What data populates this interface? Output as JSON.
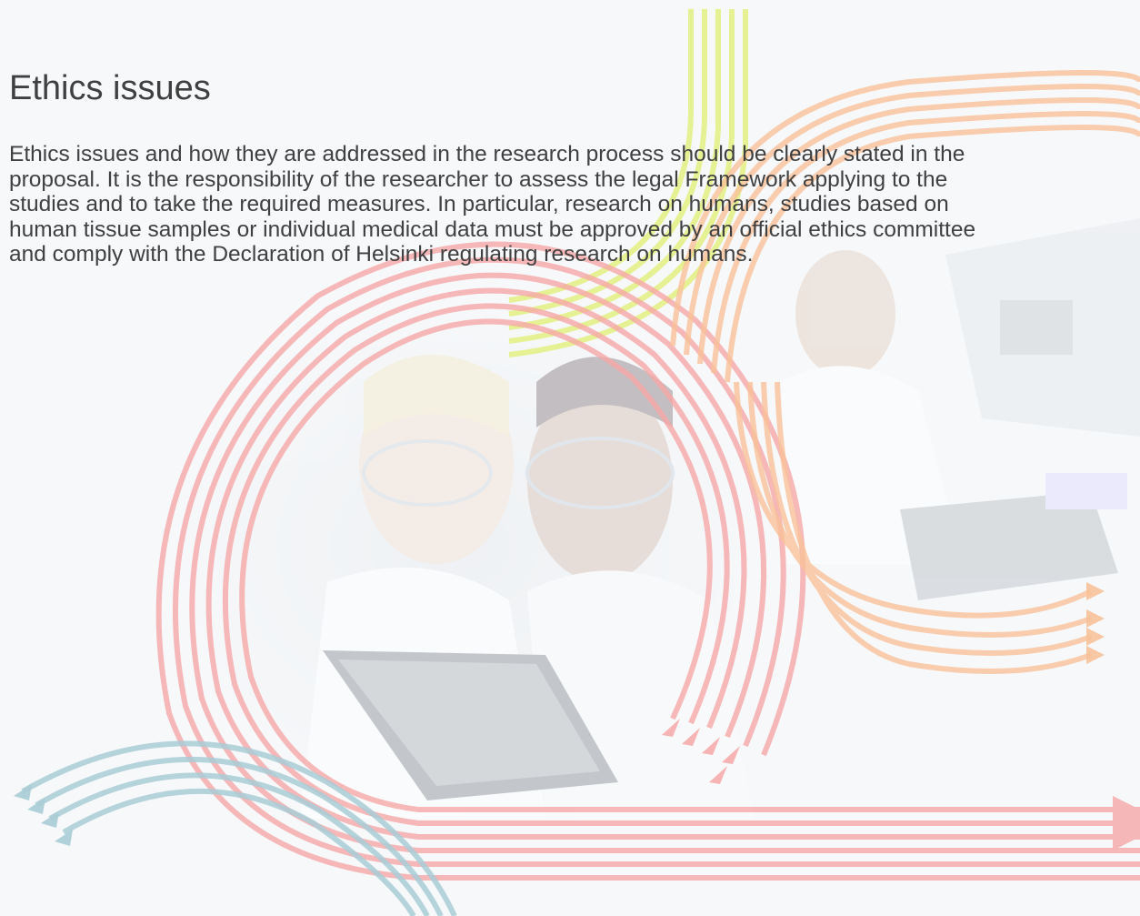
{
  "slide": {
    "title": "Ethics issues",
    "body_lines": [
      "Ethics issues and how they are addressed in the research process should be clearly stated in the",
      "proposal. It is the responsibility of the researcher to assess the legal Framework applying to the",
      "studies and to take the required measures. In particular, research on humans, studies based on",
      "human tissue samples or individual medical data must be approved by an official ethics committee",
      "and comply with the Declaration of Helsinki regulating research on humans."
    ]
  },
  "colors": {
    "text": "#404040",
    "background": "#f6f8fa",
    "swirl_red": "#f7a8a8",
    "swirl_orange": "#f9c29a",
    "swirl_yellow": "#e2f07a",
    "swirl_teal": "#a9cdd6"
  },
  "background_image": {
    "icon": "lab-researchers-photo"
  }
}
